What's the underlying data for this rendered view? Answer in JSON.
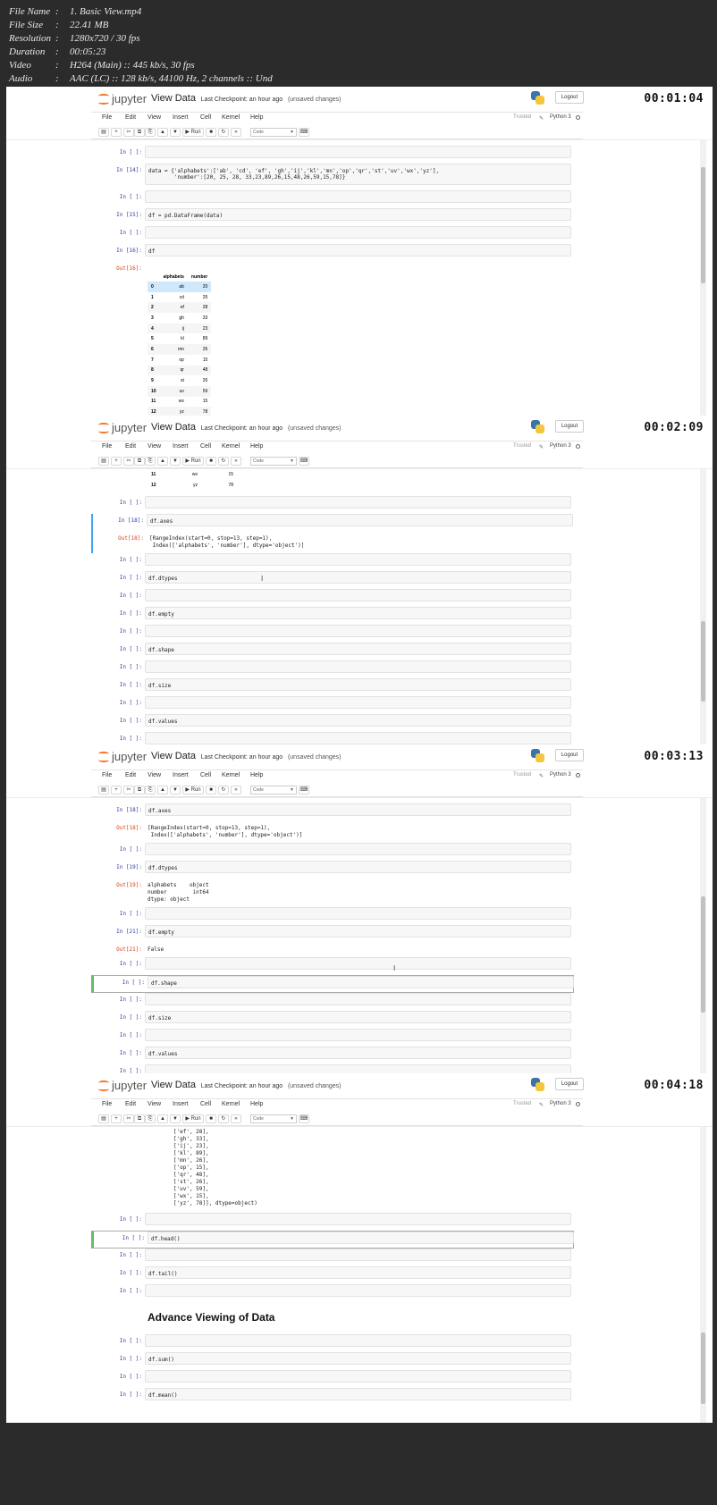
{
  "meta": [
    {
      "key": "File Name",
      "sep": ":",
      "value": "1. Basic View.mp4"
    },
    {
      "key": "File Size",
      "sep": ":",
      "value": "22.41 MB"
    },
    {
      "key": "Resolution",
      "sep": ":",
      "value": "1280x720 / 30 fps"
    },
    {
      "key": "Duration",
      "sep": ":",
      "value": "00:05:23"
    },
    {
      "key": "Video",
      "sep": ":",
      "value": "H264 (Main) :: 445 kb/s, 30 fps"
    },
    {
      "key": "Audio",
      "sep": ":",
      "value": "AAC (LC) :: 128 kb/s, 44100 Hz, 2 channels :: Und"
    }
  ],
  "jupyter": {
    "logo": "jupyter",
    "notebook_name": "View Data",
    "checkpoint": "Last Checkpoint: an hour ago",
    "unsaved": "(unsaved changes)",
    "logout": "Logout",
    "menu": [
      "File",
      "Edit",
      "View",
      "Insert",
      "Cell",
      "Kernel",
      "Help"
    ],
    "trusted": "Trusted",
    "kernel": "Python 3",
    "run_label": "Run",
    "cell_type": "Code",
    "toolbar_icons": [
      "save-icon",
      "plus-icon",
      "cut-icon",
      "copy-icon",
      "paste-icon",
      "up-icon",
      "down-icon",
      "run-icon",
      "stop-icon",
      "restart-icon",
      "fast-forward-icon",
      "keyboard-icon"
    ],
    "toolbar_glyphs": [
      "▤",
      "+",
      "✂",
      "⧉",
      "⎘",
      "▲",
      "▼",
      "▶",
      "■",
      "↻",
      "»",
      "⌨"
    ]
  },
  "frames": [
    {
      "timestamp": "00:01:04",
      "cells": [
        {
          "prompt": "In [ ]:",
          "code": "",
          "h": 12
        },
        {
          "prompt": "In [14]:",
          "code": "data = {'alphabets':['ab', 'cd', 'ef', 'gh','ij','kl','mn','op','qr','st','uv','wx','yz'],\n        'number':[20, 25, 28, 33,23,89,26,15,48,26,59,15,78]}",
          "h": 22
        },
        {
          "prompt": "In [ ]:",
          "code": "",
          "h": 12
        },
        {
          "prompt": "In [15]:",
          "code": "df = pd.DataFrame(data)",
          "h": 12
        },
        {
          "prompt": "In [ ]:",
          "code": "",
          "h": 12
        },
        {
          "prompt": "In [16]:",
          "code": "df",
          "h": 12
        },
        {
          "prompt": "Out[16]:",
          "out": true
        }
      ],
      "table": {
        "columns": [
          "",
          "alphabets",
          "number"
        ],
        "rows": [
          [
            "0",
            "ab",
            "20"
          ],
          [
            "1",
            "cd",
            "25"
          ],
          [
            "2",
            "ef",
            "28"
          ],
          [
            "3",
            "gh",
            "33"
          ],
          [
            "4",
            "ij",
            "23"
          ],
          [
            "5",
            "kl",
            "89"
          ],
          [
            "6",
            "mn",
            "26"
          ],
          [
            "7",
            "op",
            "15"
          ],
          [
            "8",
            "qr",
            "48"
          ],
          [
            "9",
            "st",
            "26"
          ],
          [
            "10",
            "uv",
            "59"
          ],
          [
            "11",
            "wx",
            "15"
          ],
          [
            "12",
            "yz",
            "78"
          ]
        ]
      }
    },
    {
      "timestamp": "00:02:09",
      "table_tail": [
        [
          "11",
          "wx",
          "15"
        ],
        [
          "12",
          "yz",
          "78"
        ]
      ],
      "cells": [
        {
          "prompt": "In [ ]:",
          "code": "",
          "h": 12
        },
        {
          "prompt": "In [18]:",
          "code": "df.axes",
          "h": 12
        },
        {
          "prompt": "Out[18]:",
          "output": "[RangeIndex(start=0, stop=13, step=1),\n Index(['alphabets', 'number'], dtype='object')]"
        },
        {
          "prompt": "In [ ]:",
          "code": "",
          "h": 12
        },
        {
          "prompt": "In [ ]:",
          "code": "df.dtypes",
          "h": 12
        },
        {
          "prompt": "In [ ]:",
          "code": "",
          "h": 12
        },
        {
          "prompt": "In [ ]:",
          "code": "df.empty",
          "h": 12
        },
        {
          "prompt": "In [ ]:",
          "code": "",
          "h": 12
        },
        {
          "prompt": "In [ ]:",
          "code": "df.shape",
          "h": 12
        },
        {
          "prompt": "In [ ]:",
          "code": "",
          "h": 12
        },
        {
          "prompt": "In [ ]:",
          "code": "df.size",
          "h": 12
        },
        {
          "prompt": "In [ ]:",
          "code": "",
          "h": 12
        },
        {
          "prompt": "In [ ]:",
          "code": "df.values",
          "h": 12
        },
        {
          "prompt": "In [ ]:",
          "code": "",
          "h": 12
        }
      ]
    },
    {
      "timestamp": "00:03:13",
      "cells": [
        {
          "prompt": "In [18]:",
          "code": "df.axes",
          "h": 12
        },
        {
          "prompt": "Out[18]:",
          "output": "[RangeIndex(start=0, stop=13, step=1),\n Index(['alphabets', 'number'], dtype='object')]"
        },
        {
          "prompt": "In [ ]:",
          "code": "",
          "h": 12
        },
        {
          "prompt": "In [19]:",
          "code": "df.dtypes",
          "h": 12
        },
        {
          "prompt": "Out[19]:",
          "output": "alphabets    object\nnumber        int64\ndtype: object"
        },
        {
          "prompt": "In [ ]:",
          "code": "",
          "h": 12
        },
        {
          "prompt": "In [21]:",
          "code": "df.empty",
          "h": 12
        },
        {
          "prompt": "Out[21]:",
          "output": "False"
        },
        {
          "prompt": "In [ ]:",
          "code": "",
          "h": 12
        },
        {
          "prompt": "In [ ]:",
          "code": "df.shape",
          "h": 12
        },
        {
          "prompt": "In [ ]:",
          "code": "",
          "h": 12
        },
        {
          "prompt": "In [ ]:",
          "code": "df.size",
          "h": 12
        },
        {
          "prompt": "In [ ]:",
          "code": "",
          "h": 12
        },
        {
          "prompt": "In [ ]:",
          "code": "df.values",
          "h": 12
        },
        {
          "prompt": "In [ ]:",
          "code": "",
          "h": 12
        }
      ]
    },
    {
      "timestamp": "00:04:18",
      "values_output": "        ['cd', 25],\n        ['ef', 28],\n        ['gh', 33],\n        ['ij', 23],\n        ['kl', 89],\n        ['mn', 26],\n        ['op', 15],\n        ['qr', 48],\n        ['st', 26],\n        ['uv', 59],\n        ['wx', 15],\n        ['yz', 78]], dtype=object)",
      "cells": [
        {
          "prompt": "In [ ]:",
          "code": "",
          "h": 12
        },
        {
          "prompt": "In [ ]:",
          "code": "df.head()",
          "h": 12
        },
        {
          "prompt": "In [ ]:",
          "code": "",
          "h": 12
        },
        {
          "prompt": "In [ ]:",
          "code": "df.tail()",
          "h": 12
        },
        {
          "prompt": "In [ ]:",
          "code": "",
          "h": 12
        }
      ],
      "heading": "Advance Viewing of Data",
      "cells_after": [
        {
          "prompt": "In [ ]:",
          "code": "",
          "h": 12
        },
        {
          "prompt": "In [ ]:",
          "code": "df.sum()",
          "h": 12
        },
        {
          "prompt": "In [ ]:",
          "code": "",
          "h": 12
        },
        {
          "prompt": "In [ ]:",
          "code": "df.mean()",
          "h": 12
        }
      ]
    }
  ]
}
